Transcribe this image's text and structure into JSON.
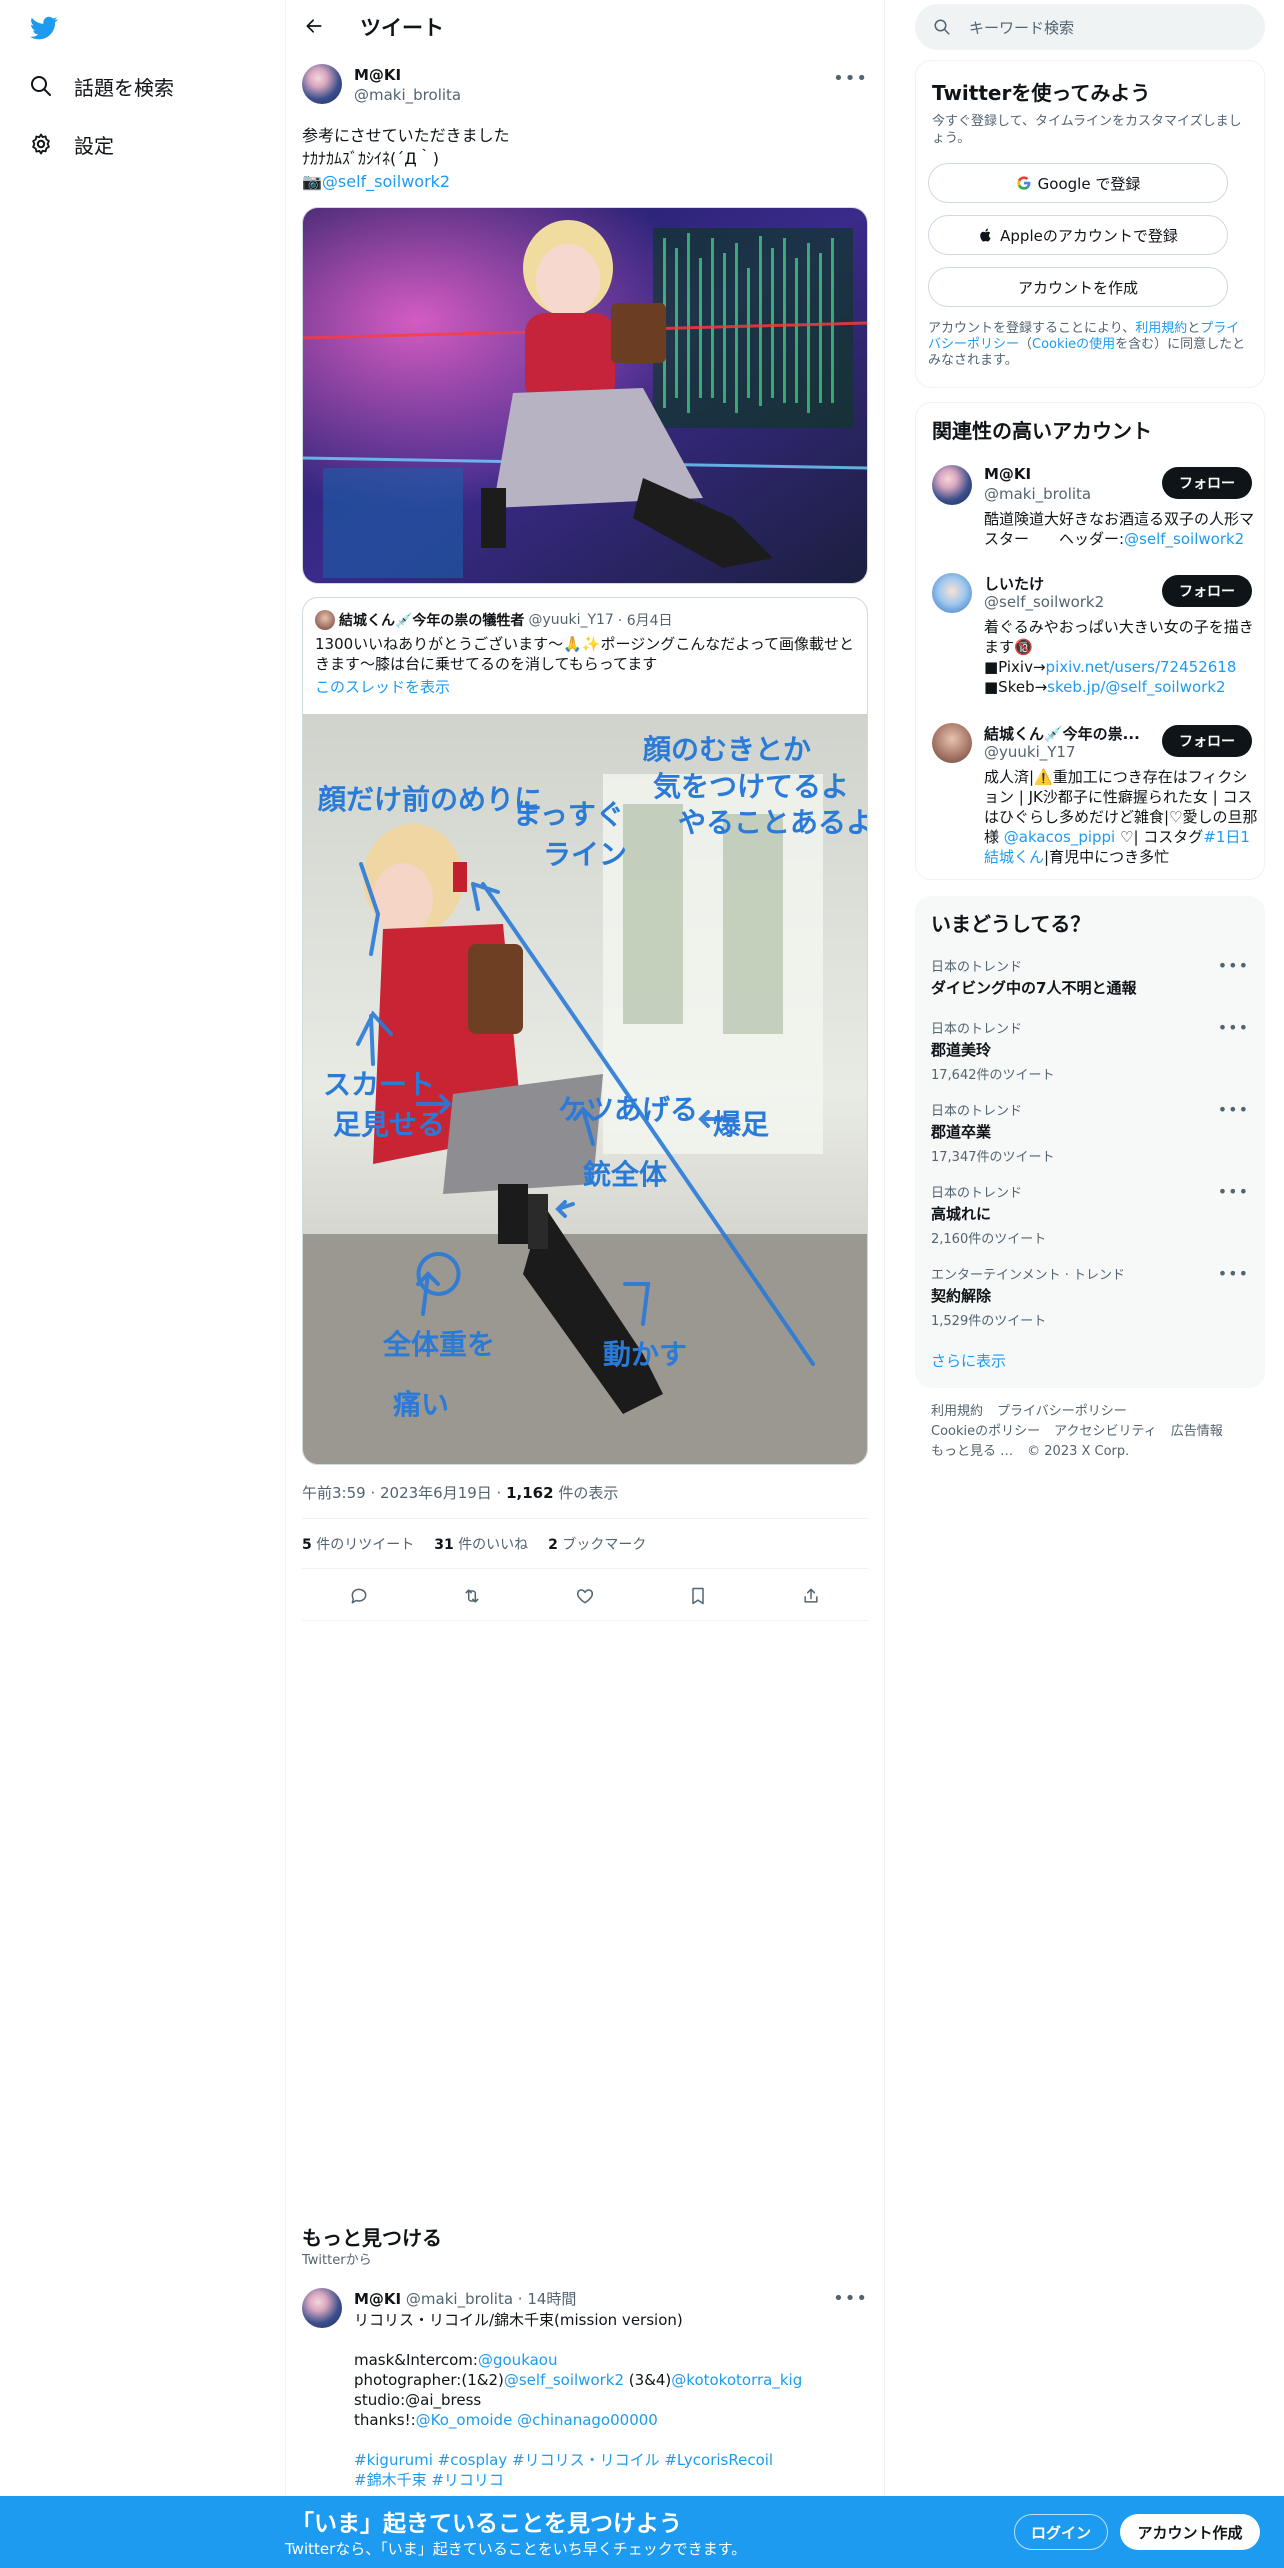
{
  "nav": {
    "explore_label": "話題を検索",
    "settings_label": "設定"
  },
  "header": {
    "title": "ツイート"
  },
  "tweet": {
    "author_name": "M@KI",
    "author_handle": "@maki_brolita",
    "text_line1": "参考にさせていただきました",
    "text_line2": "ﾅｶﾅｶﾑｽﾞｶｼｲﾈ(´Д｀)",
    "text_mention_prefix": "📷",
    "text_mention": "@self_soilwork2",
    "quote": {
      "author_name": "結城くん💉今年の祟の犠牲者",
      "author_handle": "@yuuki_Y17",
      "date": "· 6月4日",
      "text": "1300いいねありがとうございます〜🙏✨ポージングこんなだよって画像載せときます〜膝は台に乗せてるのを消してもらってます",
      "show_thread": "このスレッドを表示"
    },
    "timestamp": "午前3:59 · 2023年6月19日 · ",
    "views_count": "1,162",
    "views_label": " 件の表示",
    "retweets_count": "5",
    "retweets_label": " 件のリツイート",
    "likes_count": "31",
    "likes_label": " 件のいいね",
    "bookmarks_count": "2",
    "bookmarks_label": " ブックマーク"
  },
  "discover": {
    "title": "もっと見つける",
    "subtitle": "Twitterから",
    "tweet": {
      "author_name": "M@KI",
      "meta": "@maki_brolita · 14時間",
      "lines": [
        "リコリス・リコイル/錦木千束(mission version)",
        "",
        "mask&Intercom:@goukaou",
        "photographer:(1&2)@self_soilwork2 (3&4)@kotokotorra_kig",
        "studio:@ai_bress",
        "thanks!:@Ko_omoide @chinanago00000",
        "",
        "#kigurumi #cosplay #リコリス・リコイル #LycorisRecoil",
        "#錦木千束 #リコリコ"
      ]
    }
  },
  "search": {
    "placeholder": "キーワード検索"
  },
  "signup_card": {
    "title": "Twitterを使ってみよう",
    "subtitle": "今すぐ登録して、タイムラインをカスタマイズしましょう。",
    "google_label": "Google で登録",
    "apple_label": "Appleのアカウントで登録",
    "create_label": "アカウントを作成",
    "legal_prefix": "アカウントを登録することにより、",
    "legal_terms": "利用規約",
    "legal_and": "と",
    "legal_privacy": "プライバシーポリシー",
    "legal_paren_open": "（",
    "legal_cookie": "Cookieの使用",
    "legal_suffix": "を含む）に同意したとみなされます。"
  },
  "related": {
    "title": "関連性の高いアカウント",
    "follow_label": "フォロー",
    "accounts": [
      {
        "name": "M@KI",
        "handle": "@maki_brolita",
        "bio_text": "酷道険道大好きなお酒這る双子の人形マスター　　ヘッダー:",
        "bio_link": "@self_soilwork2"
      },
      {
        "name": "しいたけ",
        "handle": "@self_soilwork2",
        "bio_text": "着ぐるみやおっぱい大きい女の子を描きます🔞",
        "bio_line2_prefix": "■Pixiv→",
        "bio_line2_link": "pixiv.net/users/72452618",
        "bio_line3_prefix": "■Skeb→",
        "bio_line3_link": "skeb.jp/@self_soilwork2"
      },
      {
        "name": "結城くん💉今年の祟...",
        "handle": "@yuuki_Y17",
        "bio_text": "成人済|⚠️重加工につき存在はフィクション | JK沙都子に性癖握られた女 | コスはひぐらし多めだけど雑食|♡愛しの旦那様 ",
        "bio_link": "@akacos_pippi",
        "bio_text2": " ♡| コスタグ",
        "bio_link2": "#1日1結城くん",
        "bio_text3": "|育児中につき多忙"
      }
    ]
  },
  "trends": {
    "title": "いまどうしてる？",
    "items": [
      {
        "category": "日本のトレンド",
        "name": "ダイビング中の7人不明と通報",
        "count": ""
      },
      {
        "category": "日本のトレンド",
        "name": "郡道美玲",
        "count": "17,642件のツイート"
      },
      {
        "category": "日本のトレンド",
        "name": "郡道卒業",
        "count": "17,347件のツイート"
      },
      {
        "category": "日本のトレンド",
        "name": "高城れに",
        "count": "2,160件のツイート"
      },
      {
        "category": "エンターテインメント · トレンド",
        "name": "契約解除",
        "count": "1,529件のツイート"
      }
    ],
    "show_more": "さらに表示"
  },
  "footer": {
    "links": [
      "利用規約",
      "プライバシーポリシー",
      "Cookieのポリシー",
      "アクセシビリティ",
      "広告情報",
      "もっと見る …",
      "© 2023 X Corp."
    ]
  },
  "bottom_bar": {
    "headline": "「いま」起きていることを見つけよう",
    "subline": "Twitterなら、「いま」起きていることをいち早くチェックできます。",
    "login_label": "ログイン",
    "signup_label": "アカウント作成"
  },
  "colors": {
    "accent": "#1d9bf0",
    "text": "#0f1419",
    "muted": "#536471",
    "border": "#eff3f4"
  }
}
